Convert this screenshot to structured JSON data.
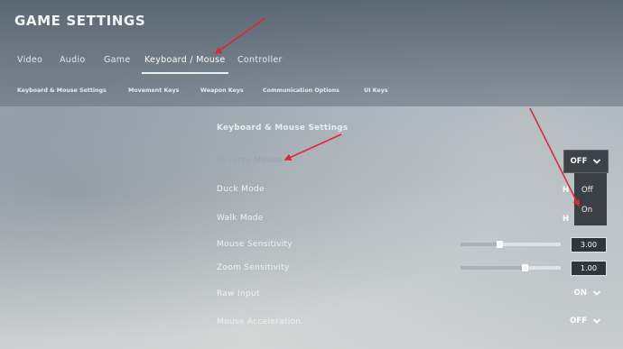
{
  "title": "GAME SETTINGS",
  "tabs": [
    {
      "label": "Video"
    },
    {
      "label": "Audio"
    },
    {
      "label": "Game"
    },
    {
      "label": "Keyboard / Mouse",
      "active": true
    },
    {
      "label": "Controller"
    }
  ],
  "subtabs": [
    {
      "label": "Keyboard & Mouse Settings"
    },
    {
      "label": "Movement Keys"
    },
    {
      "label": "Weapon Keys"
    },
    {
      "label": "Communication Options"
    },
    {
      "label": "UI Keys"
    }
  ],
  "section": {
    "title": "Keyboard & Mouse Settings"
  },
  "rows": {
    "reverse_mouse": {
      "label": "Reverse Mouse",
      "value": "OFF"
    },
    "duck_mode": {
      "label": "Duck Mode",
      "value": "H"
    },
    "walk_mode": {
      "label": "Walk Mode",
      "value": "H"
    },
    "mouse_sensitivity": {
      "label": "Mouse Sensitivity",
      "value": "3.00",
      "level": 0.39
    },
    "zoom_sensitivity": {
      "label": "Zoom Sensitivity",
      "value": "1.00",
      "level": 0.64
    },
    "raw_input": {
      "label": "Raw Input",
      "value": "ON"
    },
    "mouse_acceleration": {
      "label": "Mouse Acceleration",
      "value": "OFF"
    }
  },
  "dropdown": {
    "options": [
      "Off",
      "On"
    ]
  },
  "annotations": {
    "arrow_color": "#e0292a"
  },
  "icons": {
    "chevron": "chevron-down-icon"
  }
}
